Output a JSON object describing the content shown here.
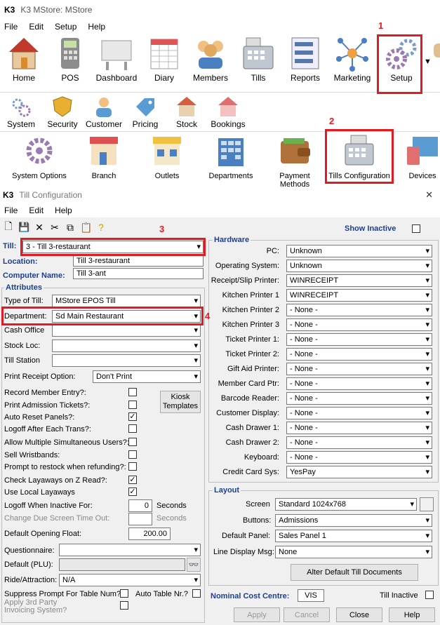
{
  "app": {
    "logo": "K3",
    "title": "K3 MStore: MStore",
    "menu": [
      "File",
      "Edit",
      "Setup",
      "Help"
    ]
  },
  "ribbon1": [
    "Home",
    "POS",
    "Dashboard",
    "Diary",
    "Members",
    "Tills",
    "Reports",
    "Marketing",
    "Setup"
  ],
  "ribbon2": [
    "System",
    "Security",
    "Customer",
    "Pricing",
    "Stock",
    "Bookings"
  ],
  "ribbon3": [
    "System Options",
    "Branch",
    "Outlets",
    "Departments",
    "Payment Methods",
    "Tills Configuration",
    "Devices"
  ],
  "annotations": [
    "1",
    "2",
    "3",
    "4"
  ],
  "dialog": {
    "logo": "K3",
    "title": "Till Configuration",
    "close": "✕",
    "menu": [
      "File",
      "Edit",
      "Help"
    ],
    "show_inactive": "Show Inactive",
    "till_label": "Till:",
    "till_value": "3 - Till 3-restaurant",
    "location_label": "Location:",
    "location_value": "Till 3-restaurant",
    "computer_label": "Computer Name:",
    "computer_value": "Till 3-ant",
    "attributes": "Attributes",
    "type_label": "Type of Till:",
    "type_value": "MStore EPOS Till",
    "dept_label": "Department:",
    "dept_value": "Sd Main Restaurant",
    "cash_office": "Cash Office",
    "stock_loc": "Stock Loc:",
    "till_station": "Till Station",
    "print_receipt_label": "Print Receipt Option:",
    "print_receipt_value": "Don't Print",
    "checks": [
      {
        "label": "Record Member Entry?:",
        "checked": false
      },
      {
        "label": "Print Admission Tickets?:",
        "checked": false
      },
      {
        "label": "Auto Reset Panels?:",
        "checked": true
      },
      {
        "label": "Logoff After Each Trans?:",
        "checked": false
      },
      {
        "label": "Allow Multiple Simultaneous Users?:",
        "checked": false
      },
      {
        "label": "Sell Wristbands:",
        "checked": false
      },
      {
        "label": "Prompt to restock when refunding?:",
        "checked": false
      },
      {
        "label": "Check Layaways on Z Read?:",
        "checked": true
      },
      {
        "label": "Use Local Layaways",
        "checked": true
      }
    ],
    "kiosk_btn": "Kiosk Templates",
    "logoff_label": "Logoff When Inactive For:",
    "logoff_value": "0",
    "seconds": "Seconds",
    "change_due_label": "Change Due Screen Time Out:",
    "seconds2": "Seconds",
    "float_label": "Default Opening Float:",
    "float_value": "200.00",
    "questionnaire": "Questionnaire:",
    "default_plu": "Default (PLU):",
    "ride_label": "Ride/Attraction:",
    "ride_value": "N/A",
    "suppress": "Suppress Prompt For Table Num?",
    "auto_table": "Auto Table Nr.?",
    "apply_3rd": "Apply 3rd Party Invoicing System?",
    "hardware": "Hardware",
    "hw": [
      {
        "label": "PC:",
        "value": "Unknown"
      },
      {
        "label": "Operating System:",
        "value": "Unknown"
      },
      {
        "label": "Receipt/Slip Printer:",
        "value": "WINRECEIPT"
      },
      {
        "label": "Kitchen Printer 1",
        "value": "WINRECEIPT"
      },
      {
        "label": "Kitchen Printer 2",
        "value": "- None -"
      },
      {
        "label": "Kitchen Printer 3",
        "value": "- None -"
      },
      {
        "label": "Ticket Printer 1:",
        "value": "- None -"
      },
      {
        "label": "Ticket Printer 2:",
        "value": "- None -"
      },
      {
        "label": "Gift Aid Printer:",
        "value": "- None -"
      },
      {
        "label": "Member Card Ptr:",
        "value": "- None -"
      },
      {
        "label": "Barcode Reader:",
        "value": "- None -"
      },
      {
        "label": "Customer Display:",
        "value": "- None -"
      },
      {
        "label": "Cash Drawer 1:",
        "value": "- None -"
      },
      {
        "label": "Cash Drawer 2:",
        "value": "- None -"
      },
      {
        "label": "Keyboard:",
        "value": "- None -"
      },
      {
        "label": "Credit Card Sys:",
        "value": "YesPay"
      }
    ],
    "layout": "Layout",
    "screen_label": "Screen",
    "screen_value": "Standard 1024x768",
    "buttons_label": "Buttons:",
    "buttons_value": "Admissions",
    "panel_label": "Default Panel:",
    "panel_value": "Sales Panel 1",
    "line_label": "Line Display Msg:",
    "line_value": "None",
    "alter_btn": "Alter Default Till Documents",
    "nominal_label": "Nominal Cost Centre:",
    "nominal_value": "VIS",
    "till_inactive": "Till Inactive",
    "footer": [
      "Apply",
      "Cancel",
      "Close",
      "Help"
    ]
  }
}
